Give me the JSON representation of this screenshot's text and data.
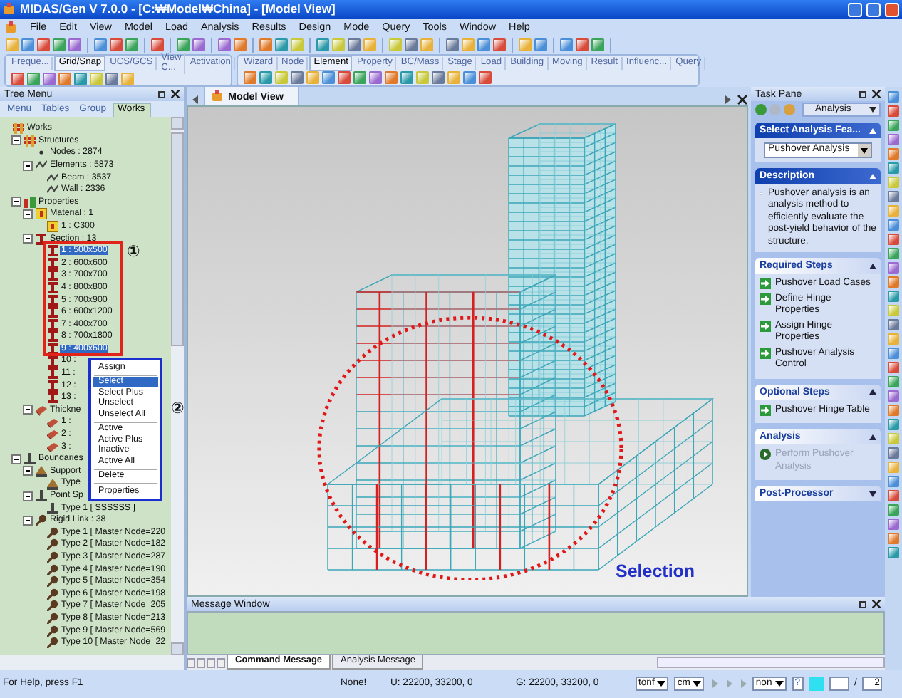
{
  "window": {
    "title": "MIDAS/Gen V 7.0.0 - [C:₩Model₩China] - [Model View]"
  },
  "menu_bar": [
    "File",
    "Edit",
    "View",
    "Model",
    "Load",
    "Analysis",
    "Results",
    "Design",
    "Mode",
    "Query",
    "Tools",
    "Window",
    "Help"
  ],
  "toolbar_tabs": {
    "left": [
      {
        "label": "Freque...",
        "selected": false
      },
      {
        "label": "Grid/Snap",
        "selected": true
      },
      {
        "label": "UCS/GCS",
        "selected": false
      },
      {
        "label": "View C...",
        "selected": false
      },
      {
        "label": "Activation",
        "selected": false
      }
    ],
    "right": [
      {
        "label": "Wizard",
        "selected": false
      },
      {
        "label": "Node",
        "selected": false
      },
      {
        "label": "Element",
        "selected": true
      },
      {
        "label": "Property",
        "selected": false
      },
      {
        "label": "BC/Mass",
        "selected": false
      },
      {
        "label": "Stage",
        "selected": false
      },
      {
        "label": "Load",
        "selected": false
      },
      {
        "label": "Building",
        "selected": false
      },
      {
        "label": "Moving",
        "selected": false
      },
      {
        "label": "Result",
        "selected": false
      },
      {
        "label": "Influenc...",
        "selected": false
      },
      {
        "label": "Query",
        "selected": false
      }
    ]
  },
  "tree_menu": {
    "title": "Tree Menu",
    "tabs": [
      {
        "label": "Menu",
        "selected": false
      },
      {
        "label": "Tables",
        "selected": false
      },
      {
        "label": "Group",
        "selected": false
      },
      {
        "label": "Works",
        "selected": true
      }
    ],
    "items": [
      {
        "label": "Works",
        "kind": "works",
        "children": [
          {
            "label": "Structures",
            "kind": "structure",
            "expanded": true,
            "children": [
              {
                "label": "Nodes : 2874",
                "kind": "node"
              },
              {
                "label": "Elements : 5873",
                "kind": "element",
                "expanded": true,
                "children": [
                  {
                    "label": "Beam : 3537",
                    "kind": "element"
                  },
                  {
                    "label": "Wall : 2336",
                    "kind": "element"
                  }
                ]
              }
            ]
          },
          {
            "label": "Properties",
            "kind": "properties",
            "expanded": true,
            "children": [
              {
                "label": "Material : 1",
                "kind": "material",
                "expanded": true,
                "children": [
                  {
                    "label": "1 : C300",
                    "kind": "material"
                  }
                ]
              },
              {
                "label": "Section : 13",
                "kind": "section",
                "expanded": true,
                "children": [
                  {
                    "label": "1 : 500x500",
                    "kind": "section",
                    "selected": true
                  },
                  {
                    "label": "2 : 600x600",
                    "kind": "section",
                    "selected": false
                  },
                  {
                    "label": "3 : 700x700",
                    "kind": "section",
                    "selected": false
                  },
                  {
                    "label": "4 : 800x800",
                    "kind": "section",
                    "selected": false
                  },
                  {
                    "label": "5 : 700x900",
                    "kind": "section",
                    "selected": false
                  },
                  {
                    "label": "6 : 600x1200",
                    "kind": "section",
                    "selected": false
                  },
                  {
                    "label": "7 : 400x700",
                    "kind": "section",
                    "selected": false
                  },
                  {
                    "label": "8 : 700x1800",
                    "kind": "section",
                    "selected": false
                  },
                  {
                    "label": "9 : 400x600",
                    "kind": "section",
                    "selected": true
                  },
                  {
                    "label": "10 :",
                    "kind": "section",
                    "selected": false
                  },
                  {
                    "label": "11 :",
                    "kind": "section",
                    "selected": false
                  },
                  {
                    "label": "12 :",
                    "kind": "section",
                    "selected": false
                  },
                  {
                    "label": "13 :",
                    "kind": "section",
                    "selected": false
                  }
                ]
              },
              {
                "label": "Thickne",
                "kind": "thickness",
                "expanded": true,
                "children": [
                  {
                    "label": "1 :",
                    "kind": "thickness"
                  },
                  {
                    "label": "2 :",
                    "kind": "thickness"
                  },
                  {
                    "label": "3 :",
                    "kind": "thickness"
                  }
                ]
              }
            ]
          },
          {
            "label": "Boundaries",
            "kind": "boundary",
            "expanded": true,
            "children": [
              {
                "label": "Support",
                "kind": "support",
                "expanded": true,
                "children": [
                  {
                    "label": "Type",
                    "kind": "support"
                  }
                ]
              },
              {
                "label": "Point Sp",
                "kind": "spring",
                "expanded": true,
                "children": [
                  {
                    "label": "Type 1 [ SSSSSS ]",
                    "kind": "spring"
                  }
                ]
              },
              {
                "label": "Rigid Link : 38",
                "kind": "link",
                "expanded": true,
                "children": [
                  {
                    "label": "Type 1 [ Master Node=220",
                    "kind": "link"
                  },
                  {
                    "label": "Type 2 [ Master Node=182",
                    "kind": "link"
                  },
                  {
                    "label": "Type 3 [ Master Node=287",
                    "kind": "link"
                  },
                  {
                    "label": "Type 4 [ Master Node=190",
                    "kind": "link"
                  },
                  {
                    "label": "Type 5 [ Master Node=354",
                    "kind": "link"
                  },
                  {
                    "label": "Type 6 [ Master Node=198",
                    "kind": "link"
                  },
                  {
                    "label": "Type 7 [ Master Node=205",
                    "kind": "link"
                  },
                  {
                    "label": "Type 8 [ Master Node=213",
                    "kind": "link"
                  },
                  {
                    "label": "Type 9 [ Master Node=569",
                    "kind": "link"
                  },
                  {
                    "label": "Type 10 [ Master Node=22",
                    "kind": "link"
                  }
                ]
              }
            ]
          }
        ]
      }
    ]
  },
  "context_menu": [
    {
      "kind": "item",
      "label": "Assign",
      "selected": false
    },
    {
      "kind": "separator"
    },
    {
      "kind": "item",
      "label": "Select",
      "selected": true
    },
    {
      "kind": "item",
      "label": "Select Plus",
      "selected": false
    },
    {
      "kind": "item",
      "label": "Unselect",
      "selected": false
    },
    {
      "kind": "item",
      "label": "Unselect All",
      "selected": false
    },
    {
      "kind": "separator"
    },
    {
      "kind": "item",
      "label": "Active",
      "selected": false
    },
    {
      "kind": "item",
      "label": "Active Plus",
      "selected": false
    },
    {
      "kind": "item",
      "label": "Inactive",
      "selected": false
    },
    {
      "kind": "item",
      "label": "Active All",
      "selected": false
    },
    {
      "kind": "separator"
    },
    {
      "kind": "item",
      "label": "Delete",
      "selected": false
    },
    {
      "kind": "separator"
    },
    {
      "kind": "item",
      "label": "Properties",
      "selected": false
    }
  ],
  "callouts": [
    "①",
    "②"
  ],
  "model_view": {
    "tab": "Model View",
    "annotation": "Selection"
  },
  "task_pane": {
    "title": "Task Pane",
    "category": "Analysis",
    "sections": [
      {
        "title": "Select Analysis Fea...",
        "special": true,
        "expanded": true,
        "kind": "dropdown",
        "value": "Pushover Analysis"
      },
      {
        "title": "Description",
        "special": true,
        "expanded": true,
        "kind": "text",
        "text": "Pushover analysis is an analysis method to efficiently evaluate the post-yield behavior of the structure."
      },
      {
        "title": "Required Steps",
        "special": false,
        "expanded": true,
        "kind": "links",
        "links": [
          {
            "label": "Pushover Load Cases",
            "disabled": false
          },
          {
            "label": "Define Hinge Properties",
            "disabled": false
          },
          {
            "label": "Assign Hinge Properties",
            "disabled": false
          },
          {
            "label": "Pushover Analysis Control",
            "disabled": false
          }
        ]
      },
      {
        "title": "Optional Steps",
        "special": false,
        "expanded": true,
        "kind": "links",
        "links": [
          {
            "label": "Pushover Hinge Table",
            "disabled": false
          }
        ]
      },
      {
        "title": "Analysis",
        "special": false,
        "expanded": true,
        "kind": "links",
        "links": [
          {
            "label": "Perform Pushover Analysis",
            "disabled": true
          }
        ]
      },
      {
        "title": "Post-Processor",
        "special": false,
        "expanded": false
      }
    ]
  },
  "message_window": {
    "title": "Message Window",
    "tabs": [
      {
        "label": "Command Message",
        "selected": true
      },
      {
        "label": "Analysis Message",
        "selected": false
      }
    ]
  },
  "status_bar": {
    "help": "For Help, press F1",
    "selection": "None!",
    "ucs": "U: 22200, 33200, 0",
    "gcs": "G: 22200, 33200, 0",
    "force_unit": "tonf",
    "length_unit": "cm",
    "filter": "non",
    "help_button": "?",
    "page_separator": "/",
    "page": "2"
  }
}
